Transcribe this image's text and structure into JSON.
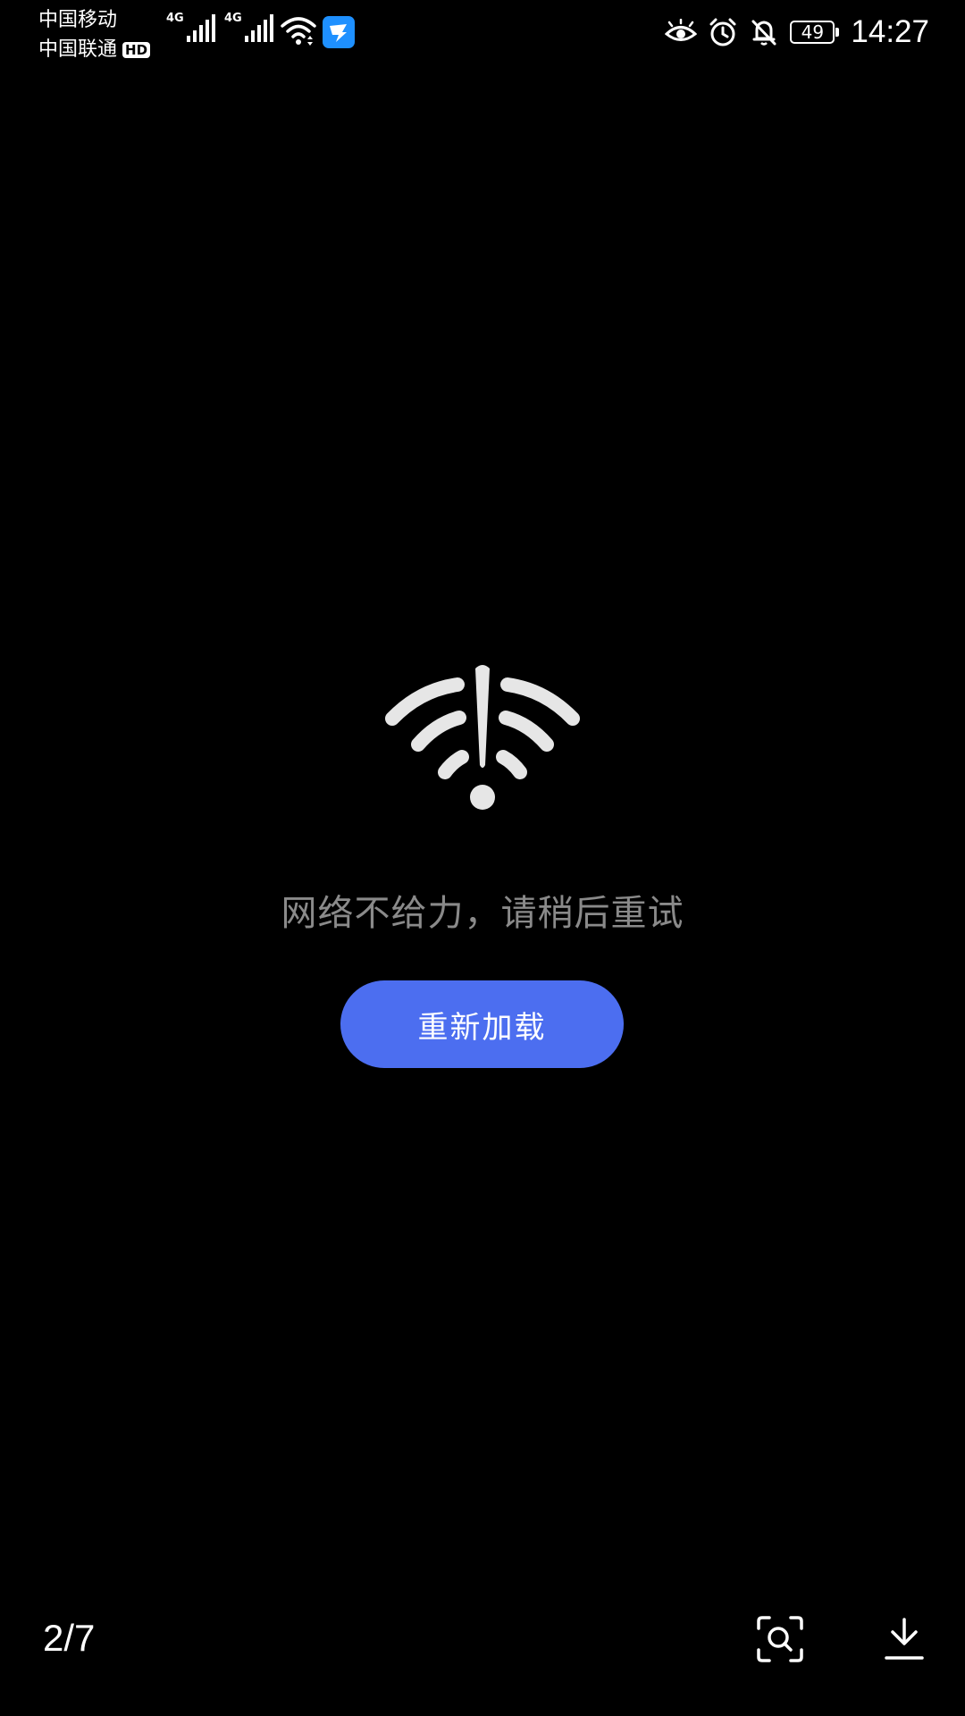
{
  "status_bar": {
    "carrier_1": "中国移动",
    "carrier_2": "中国联通",
    "hd_badge": "HD",
    "signal_1_type": "4G",
    "signal_2_type": "4G",
    "battery_level": "49",
    "time": "14:27",
    "icons": [
      "signal-icon",
      "wifi-icon",
      "app-notification-icon",
      "eye-comfort-icon",
      "alarm-icon",
      "bell-off-icon",
      "battery-icon"
    ]
  },
  "main": {
    "error_icon": "wifi-error-icon",
    "error_message": "网络不给力，请稍后重试",
    "reload_label": "重新加载"
  },
  "bottom_bar": {
    "page_indicator": "2/7",
    "icons": [
      "scan-search-icon",
      "download-icon"
    ]
  },
  "colors": {
    "background": "#000000",
    "button": "#4c6ef0",
    "message_text": "#8a8a8a",
    "icon_gray": "#e6e6e6",
    "app_badge": "#1e90ff"
  }
}
